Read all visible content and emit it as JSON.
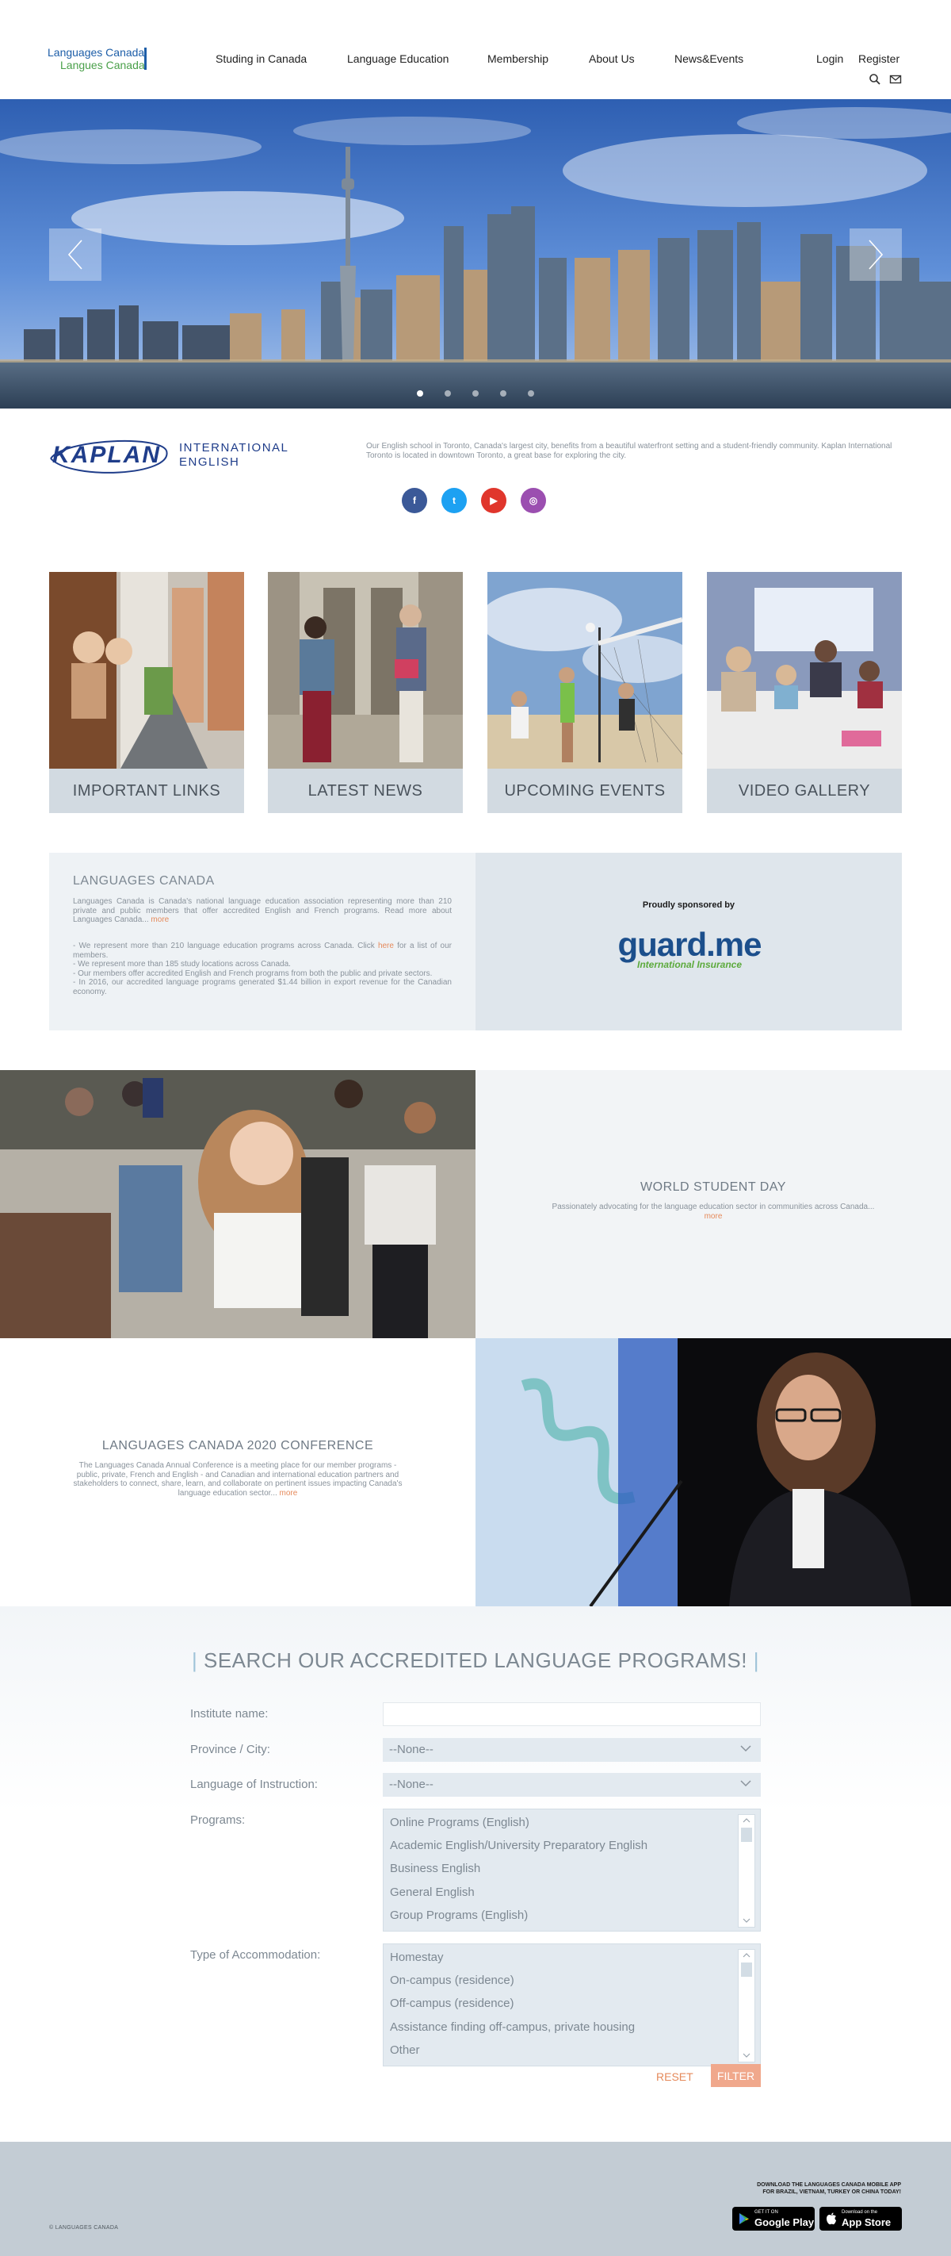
{
  "header": {
    "logo_line1": "Languages Canada",
    "logo_line2": "Langues Canada",
    "nav": [
      "Studing in Canada",
      "Language Education",
      "Membership",
      "About Us",
      "News&Events"
    ],
    "login": "Login",
    "register": "Register"
  },
  "hero": {
    "prev_icon": "chevron-left-icon",
    "next_icon": "chevron-right-icon",
    "slides": 5,
    "active_slide": 1
  },
  "kaplan": {
    "brand": "KAPLAN",
    "brand_line1": "INTERNATIONAL",
    "brand_line2": "ENGLISH",
    "description": "Our English school in Toronto, Canada's largest city, benefits from a beautiful waterfront setting and a student-friendly community. Kaplan International Toronto is located in downtown Toronto, a great base for exploring the city.",
    "social": [
      "f",
      "t",
      "▶",
      "◎"
    ]
  },
  "tiles": [
    {
      "label": "IMPORTANT LINKS"
    },
    {
      "label": "LATEST NEWS"
    },
    {
      "label": "UPCOMING EVENTS"
    },
    {
      "label": "VIDEO GALLERY"
    }
  ],
  "languages_canada": {
    "title": "LANGUAGES CANADA",
    "intro": "Languages Canada is Canada's national language education association representing more than 210 private and public members that offer accredited English and French programs. Read more about Languages Canada...",
    "more": "more",
    "bullet1_pre": "- We represent more than 210 language education programs across Canada. Click ",
    "bullet1_link": "here",
    "bullet1_post": " for a list of our members.",
    "bullet2": "- We represent more than 185 study locations across Canada.",
    "bullet3": "- Our members offer accredited English and French programs from both the public and private sectors.",
    "bullet4": "- In 2016, our accredited language programs generated $1.44 billion in export revenue for the Canadian economy.",
    "sponsor_label": "Proudly sponsored by",
    "sponsor_name": "guard.me",
    "sponsor_sub": "International Insurance"
  },
  "world_student_day": {
    "title": "WORLD STUDENT DAY",
    "text": "Passionately advocating for the language education sector in communities across Canada...",
    "more": "more"
  },
  "conference": {
    "title": "LANGUAGES CANADA 2020 CONFERENCE",
    "text": "The Languages Canada Annual Conference is a meeting place for our member programs - public, private, French and English - and Canadian and international education partners and stakeholders to connect, share, learn, and collaborate on pertinent issues impacting Canada's language education sector...",
    "more": "more"
  },
  "search": {
    "title": "SEARCH OUR ACCREDITED LANGUAGE PROGRAMS!",
    "institute_label": "Institute name:",
    "institute_value": "",
    "province_label": "Province / City:",
    "province_value": "--None--",
    "language_label": "Language of Instruction:",
    "language_value": "--None--",
    "programs_label": "Programs:",
    "programs": [
      "Online Programs (English)",
      "Academic English/University Preparatory English",
      "Business English",
      "General English",
      "Group Programs (English)"
    ],
    "accommodation_label": "Type of Accommodation:",
    "accommodations": [
      "Homestay",
      "On-campus (residence)",
      "Off-campus (residence)",
      "Assistance finding off-campus, private housing",
      "Other"
    ],
    "reset": "RESET",
    "filter": "FILTER"
  },
  "footer": {
    "copyright": "© LANGUAGES CANADA",
    "app_line1": "DOWNLOAD THE LANGUAGES CANADA MOBILE APP",
    "app_line2": "FOR BRAZIL, VIETNAM, TURKEY OR CHINA TODAY!",
    "google_small": "GET IT ON",
    "google_big": "Google Play",
    "apple_small": "Download on the",
    "apple_big": "App Store"
  }
}
